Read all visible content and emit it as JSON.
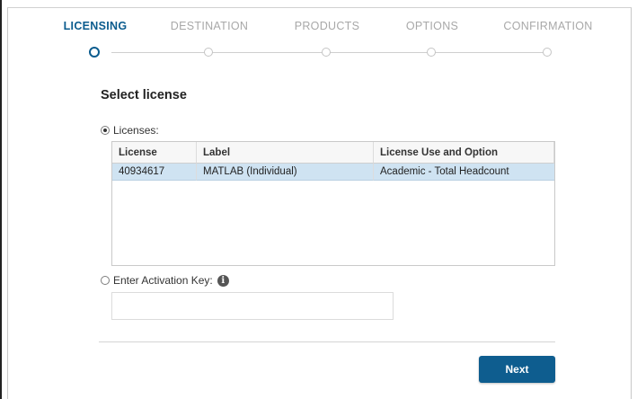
{
  "steps": [
    {
      "label": "LICENSING",
      "active": true
    },
    {
      "label": "DESTINATION",
      "active": false
    },
    {
      "label": "PRODUCTS",
      "active": false
    },
    {
      "label": "OPTIONS",
      "active": false
    },
    {
      "label": "CONFIRMATION",
      "active": false
    }
  ],
  "section": {
    "title": "Select license"
  },
  "licenses_option": {
    "label": "Licenses:",
    "selected": true
  },
  "table": {
    "headers": [
      "License",
      "Label",
      "License Use and Option"
    ],
    "rows": [
      [
        "40934617",
        "MATLAB (Individual)",
        "Academic - Total Headcount"
      ]
    ]
  },
  "activation_option": {
    "label": "Enter Activation Key:",
    "selected": false,
    "info_icon": "info-icon"
  },
  "activation_key": {
    "value": "",
    "placeholder": ""
  },
  "buttons": {
    "next_label": "Next"
  },
  "colors": {
    "accent": "#0b5c8e",
    "selected_row": "#cfe3f2",
    "button": "#0e5d8f"
  }
}
